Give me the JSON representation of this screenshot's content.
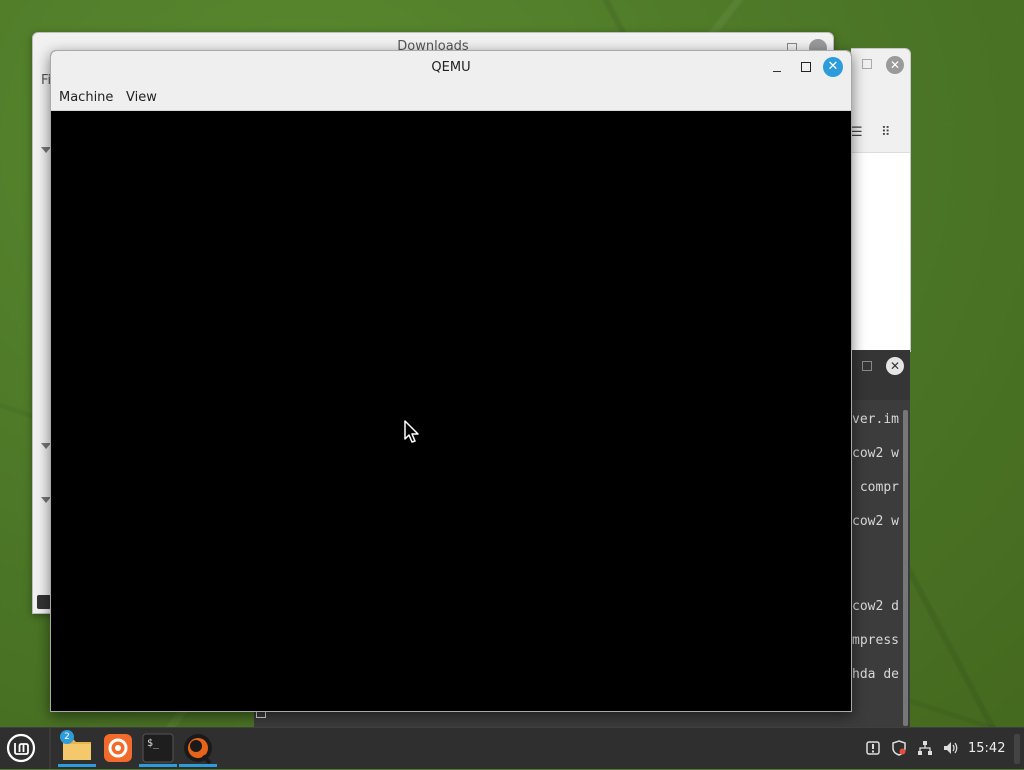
{
  "qemu": {
    "title": "QEMU",
    "menu": [
      "Machine",
      "View"
    ],
    "controls": {
      "minimize": "–",
      "maximize": "□",
      "close": "✕"
    }
  },
  "file_manager": {
    "title": "Downloads",
    "menu_partial": "Fi"
  },
  "terminal": {
    "lines": [
      "ver.im",
      "cow2 w",
      " compr",
      "cow2 w",
      "",
      "",
      "cow2 d",
      "mpress",
      "hda de"
    ]
  },
  "taskbar": {
    "apps": [
      {
        "name": "Files",
        "badge": "2",
        "active": true
      },
      {
        "name": "Firefox",
        "badge": "",
        "active": false
      },
      {
        "name": "Terminal",
        "badge": "",
        "active": true
      },
      {
        "name": "QEMU",
        "badge": "",
        "active": true
      }
    ],
    "terminal_icon_text": "$_",
    "clock": "15:42"
  },
  "colors": {
    "accent": "#2d9cdb",
    "desktop": "#4f7a2a",
    "taskbar": "#2f2f2f"
  }
}
